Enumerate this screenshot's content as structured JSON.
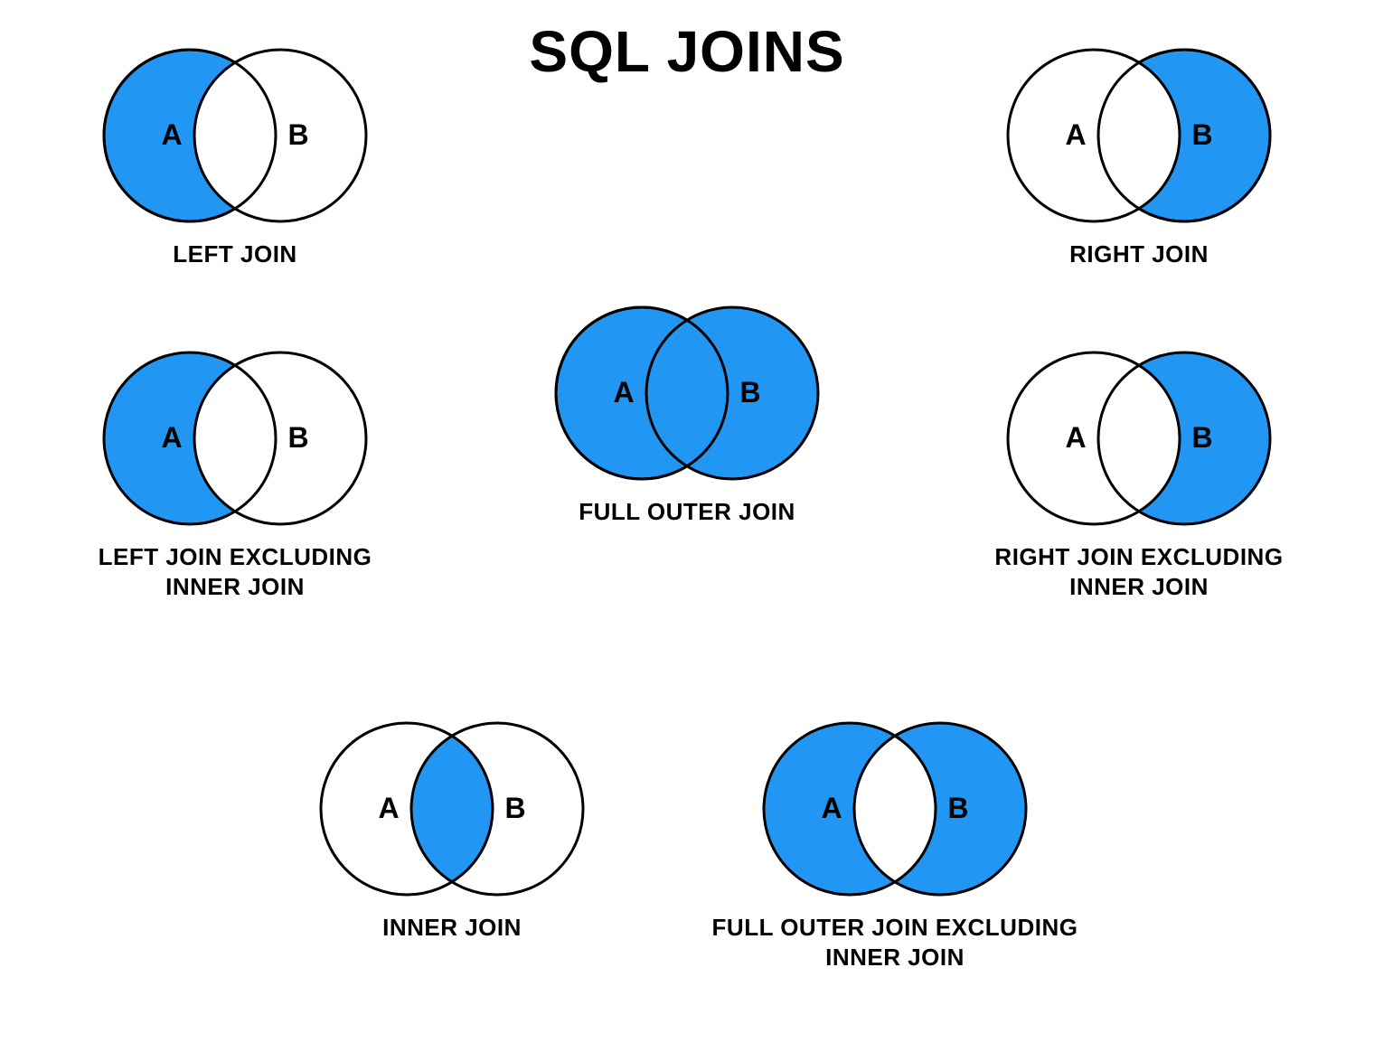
{
  "title": "SQL JOINS",
  "colors": {
    "fill": "#2196f3",
    "stroke": "#000000",
    "bg": "#ffffff"
  },
  "labels": {
    "a": "A",
    "b": "B"
  },
  "joins": {
    "left": {
      "caption": "LEFT JOIN"
    },
    "right": {
      "caption": "RIGHT JOIN"
    },
    "full_outer": {
      "caption": "FULL OUTER JOIN"
    },
    "left_excl": {
      "caption": "LEFT JOIN EXCLUDING\nINNER JOIN"
    },
    "right_excl": {
      "caption": "RIGHT JOIN EXCLUDING\nINNER JOIN"
    },
    "inner": {
      "caption": "INNER JOIN"
    },
    "full_outer_excl": {
      "caption": "FULL OUTER JOIN EXCLUDING\nINNER JOIN"
    }
  }
}
